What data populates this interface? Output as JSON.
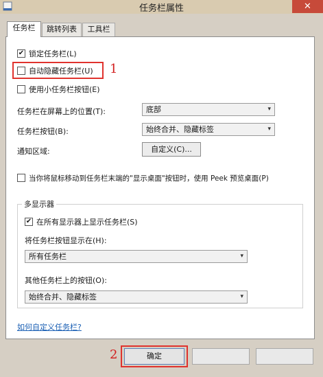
{
  "window": {
    "title": "任务栏属性",
    "close_glyph": "✕"
  },
  "tabs": [
    {
      "label": "任务栏",
      "active": true
    },
    {
      "label": "跳转列表",
      "active": false
    },
    {
      "label": "工具栏",
      "active": false
    }
  ],
  "taskbar": {
    "lock_label": "锁定任务栏(L)",
    "lock_checked": true,
    "autohide_label": "自动隐藏任务栏(U)",
    "autohide_checked": false,
    "small_buttons_label": "使用小任务栏按钮(E)",
    "small_buttons_checked": false,
    "position_label": "任务栏在屏幕上的位置(T):",
    "position_value": "底部",
    "buttons_label": "任务栏按钮(B):",
    "buttons_value": "始终合并、隐藏标签",
    "notify_label": "通知区域:",
    "customize_button": "自定义(C)...",
    "peek_label": "当你将鼠标移动到任务栏末端的\"显示桌面\"按钮时，使用 Peek 预览桌面(P)",
    "peek_checked": false
  },
  "multi_display": {
    "group_title": "多显示器",
    "show_all_label": "在所有显示器上显示任务栏(S)",
    "show_all_checked": true,
    "show_buttons_on_label": "将任务栏按钮显示在(H):",
    "show_buttons_on_value": "所有任务栏",
    "other_buttons_label": "其他任务栏上的按钮(O):",
    "other_buttons_value": "始终合并、隐藏标签"
  },
  "help_link": "如何自定义任务栏?",
  "footer": {
    "ok_button": "确定",
    "cancel_button": "",
    "apply_button": ""
  },
  "annotations": {
    "step1": "1",
    "step2": "2"
  },
  "colors": {
    "annotation_red": "#e0322d",
    "link_blue": "#1a5fb4",
    "titlebar": "#d9cbb0"
  }
}
